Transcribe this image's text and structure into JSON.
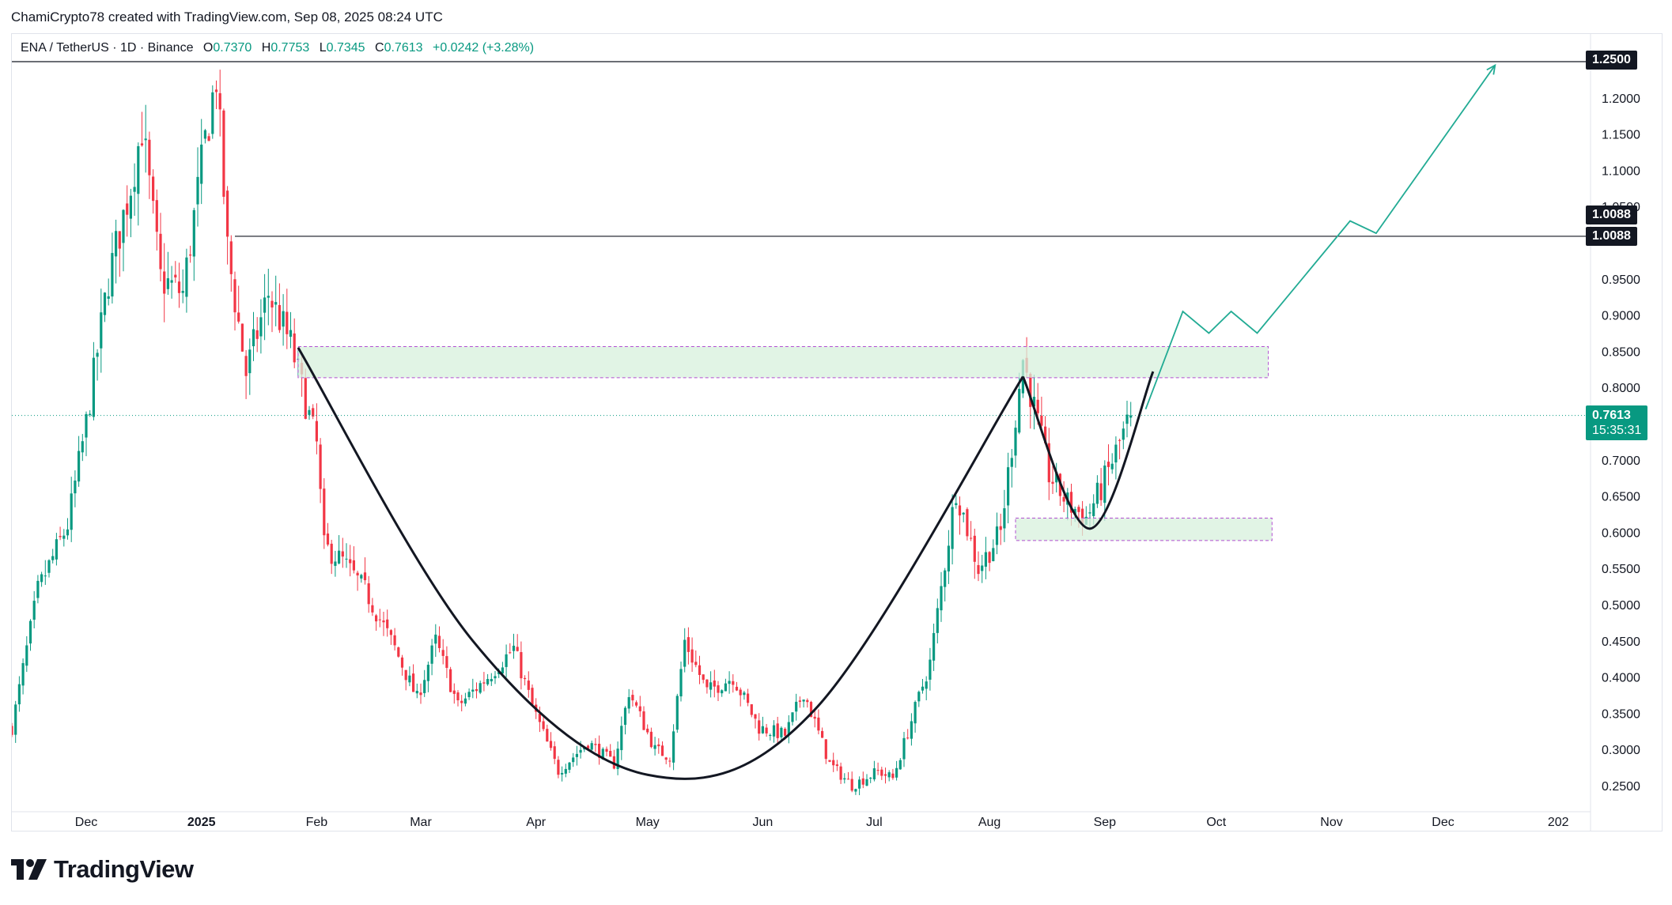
{
  "header": {
    "caption": "ChamiCrypto78 created with TradingView.com, Sep 08, 2025 08:24 UTC"
  },
  "legend": {
    "symbol": "ENA / TetherUS · 1D · Binance",
    "open_label": "O",
    "open": "0.7370",
    "high_label": "H",
    "high": "0.7753",
    "low_label": "L",
    "low": "0.7345",
    "close_label": "C",
    "close": "0.7613",
    "change": "+0.0242 (+3.28%)"
  },
  "price_tags": {
    "target": "1.2500",
    "resistance_a": "1.0088",
    "resistance_b": "1.0088",
    "current_price": "0.7613",
    "countdown": "15:35:31"
  },
  "branding": {
    "logo_text": "TradingView"
  },
  "colors": {
    "up": "#089981",
    "down": "#f23645",
    "zone_fill": "#d7f0dc",
    "zone_border": "#b24fd2",
    "projection": "#22ab94",
    "price_line": "#089981"
  },
  "chart_data": {
    "type": "candlestick",
    "x_axis": {
      "tick_labels": [
        "Dec",
        "2025",
        "Feb",
        "Mar",
        "Apr",
        "May",
        "Jun",
        "Jul",
        "Aug",
        "Sep",
        "Oct",
        "Nov",
        "Dec",
        "202"
      ]
    },
    "y_axis": {
      "tick_labels": [
        "1.2000",
        "1.1500",
        "1.1000",
        "1.0500",
        "0.9500",
        "0.9000",
        "0.8500",
        "0.8000",
        "0.7000",
        "0.6500",
        "0.6000",
        "0.5500",
        "0.5000",
        "0.4500",
        "0.4000",
        "0.3500",
        "0.3000",
        "0.2500"
      ],
      "range": [
        0.225,
        1.29
      ]
    },
    "horizontal_levels": [
      1.25,
      1.0088
    ],
    "zones": [
      {
        "from_date": "2025-01-27",
        "to_date": "2025-10-15",
        "low": 0.8135,
        "high": 0.8565
      },
      {
        "from_date": "2025-08-08",
        "to_date": "2025-10-16",
        "low": 0.5885,
        "high": 0.6195
      }
    ],
    "cup_and_handle": {
      "cup": [
        [
          "2025-01-27",
          0.855
        ],
        [
          "2025-03-15",
          0.45
        ],
        [
          "2025-05-01",
          0.265
        ],
        [
          "2025-06-15",
          0.355
        ],
        [
          "2025-08-10",
          0.815
        ]
      ],
      "handle": [
        [
          "2025-08-10",
          0.815
        ],
        [
          "2025-08-28",
          0.605
        ],
        [
          "2025-09-14",
          0.822
        ]
      ]
    },
    "projection": [
      [
        "2025-09-12",
        0.77
      ],
      [
        "2025-09-22",
        0.905
      ],
      [
        "2025-09-29",
        0.875
      ],
      [
        "2025-10-05",
        0.905
      ],
      [
        "2025-10-12",
        0.875
      ],
      [
        "2025-11-06",
        1.03
      ],
      [
        "2025-11-13",
        1.013
      ],
      [
        "2025-12-15",
        1.245
      ]
    ],
    "current_price": 0.7613,
    "candles_summary": {
      "symbol": "ENA/USDT",
      "interval": "1D",
      "first_date": "2024-11-11",
      "last_date": "2025-09-08",
      "last_bar": {
        "open": 0.737,
        "high": 0.7753,
        "low": 0.7345,
        "close": 0.7613
      }
    },
    "price_path_keypoints": [
      [
        "2024-11-11",
        0.33
      ],
      [
        "2024-11-18",
        0.52
      ],
      [
        "2024-11-26",
        0.61
      ],
      [
        "2024-12-01",
        0.75
      ],
      [
        "2024-12-07",
        0.95
      ],
      [
        "2024-12-13",
        1.08
      ],
      [
        "2024-12-16",
        1.16
      ],
      [
        "2024-12-21",
        0.95
      ],
      [
        "2024-12-27",
        0.93
      ],
      [
        "2025-01-02",
        1.14
      ],
      [
        "2025-01-05",
        1.23
      ],
      [
        "2025-01-08",
        0.99
      ],
      [
        "2025-01-13",
        0.82
      ],
      [
        "2025-01-19",
        0.93
      ],
      [
        "2025-01-25",
        0.86
      ],
      [
        "2025-02-01",
        0.72
      ],
      [
        "2025-02-03",
        0.58
      ],
      [
        "2025-02-08",
        0.56
      ],
      [
        "2025-02-14",
        0.52
      ],
      [
        "2025-02-22",
        0.44
      ],
      [
        "2025-02-28",
        0.37
      ],
      [
        "2025-03-05",
        0.45
      ],
      [
        "2025-03-11",
        0.36
      ],
      [
        "2025-03-19",
        0.4
      ],
      [
        "2025-03-26",
        0.44
      ],
      [
        "2025-03-31",
        0.36
      ],
      [
        "2025-04-07",
        0.27
      ],
      [
        "2025-04-15",
        0.31
      ],
      [
        "2025-04-22",
        0.28
      ],
      [
        "2025-04-26",
        0.38
      ],
      [
        "2025-05-03",
        0.3
      ],
      [
        "2025-05-07",
        0.29
      ],
      [
        "2025-05-11",
        0.45
      ],
      [
        "2025-05-17",
        0.38
      ],
      [
        "2025-05-24",
        0.4
      ],
      [
        "2025-05-31",
        0.33
      ],
      [
        "2025-06-07",
        0.32
      ],
      [
        "2025-06-12",
        0.38
      ],
      [
        "2025-06-19",
        0.28
      ],
      [
        "2025-06-25",
        0.25
      ],
      [
        "2025-07-02",
        0.27
      ],
      [
        "2025-07-06",
        0.26
      ],
      [
        "2025-07-11",
        0.34
      ],
      [
        "2025-07-16",
        0.42
      ],
      [
        "2025-07-23",
        0.66
      ],
      [
        "2025-07-29",
        0.55
      ],
      [
        "2025-08-04",
        0.6
      ],
      [
        "2025-08-10",
        0.84
      ],
      [
        "2025-08-17",
        0.68
      ],
      [
        "2025-08-22",
        0.64
      ],
      [
        "2025-08-27",
        0.62
      ],
      [
        "2025-08-31",
        0.66
      ],
      [
        "2025-09-08",
        0.7613
      ]
    ]
  }
}
